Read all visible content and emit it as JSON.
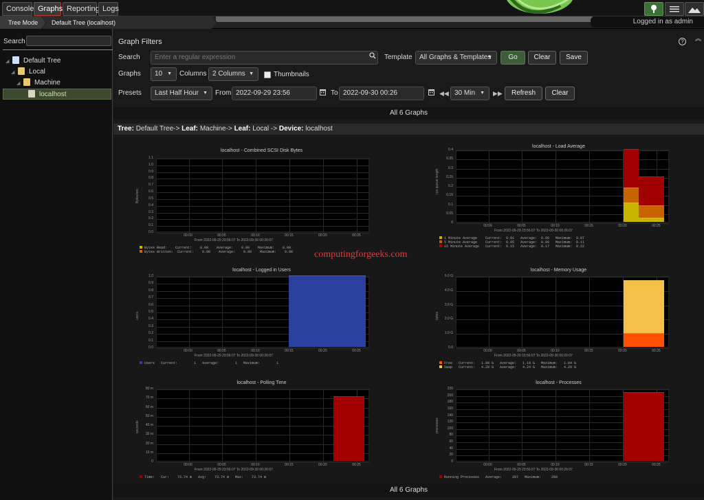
{
  "top_tabs": [
    "Console",
    "Graphs",
    "Reporting",
    "Logs"
  ],
  "active_tab": "Graphs",
  "top_icons": [
    "tree-icon",
    "list-icon",
    "preview-icon"
  ],
  "crumbs": [
    "Tree Mode",
    "Default Tree (localhost)"
  ],
  "login_text": "Logged in as admin",
  "sidebar": {
    "search_label": "Search",
    "tree": [
      {
        "label": "Default Tree",
        "icon": "tree-root-icon",
        "level": 0
      },
      {
        "label": "Local",
        "icon": "folder-icon",
        "level": 1
      },
      {
        "label": "Machine",
        "icon": "folder-icon",
        "level": 2
      },
      {
        "label": "localhost",
        "icon": "device-icon",
        "level": 3,
        "selected": true
      }
    ]
  },
  "filters": {
    "title": "Graph Filters",
    "search_label": "Search",
    "search_placeholder": "Enter a regular expression",
    "template_label": "Template",
    "template_value": "All Graphs & Templates",
    "go": "Go",
    "clear": "Clear",
    "save": "Save",
    "graphs_label": "Graphs",
    "graphs_value": "10",
    "columns_label": "Columns",
    "columns_value": "2 Columns",
    "thumbnails_label": "Thumbnails",
    "presets_label": "Presets",
    "presets_value": "Last Half Hour",
    "from_label": "From",
    "from_value": "2022-09-29 23:56",
    "to_label": "To",
    "to_value": "2022-09-30 00:26",
    "interval_value": "30 Min",
    "refresh": "Refresh",
    "clear2": "Clear"
  },
  "count_label": "All 6 Graphs",
  "tree_path": {
    "tree_k": "Tree:",
    "tree_v": "Default Tree->",
    "leaf1_k": "Leaf:",
    "leaf1_v": "Machine->",
    "leaf2_k": "Leaf:",
    "leaf2_v": "Local ->",
    "device_k": "Device:",
    "device_v": "localhost"
  },
  "watermark": "computingforgeeks.com",
  "x_ticks": [
    "00:00",
    "00:05",
    "00:10",
    "00:15",
    "00:20",
    "00:25"
  ],
  "graphs": [
    {
      "title": "localhost - Combined SCSI Disk Bytes",
      "ylabel": "Bytes/sec",
      "yticks": [
        "1.1",
        "1.0",
        "0.9",
        "0.8",
        "0.7",
        "0.6",
        "0.5",
        "0.4",
        "0.3",
        "0.2",
        "0.1",
        "0.0"
      ],
      "from": "From 2022-09-29 23:56:07 To 2022-09-30 00:26:07",
      "legend": [
        {
          "color": "#d4b800",
          "text": "Bytes Read:    Current:    0.00    Average:    0.00    Maximum:    0.00"
        },
        {
          "color": "#e06000",
          "text": "Bytes Written:  Current:    0.00    Average:    0.00    Maximum:    0.00"
        }
      ]
    },
    {
      "title": "localhost - Load Average",
      "ylabel": "run queue length",
      "yticks": [
        "0.4",
        "0.35",
        "0.3",
        "0.25",
        "0.2",
        "0.15",
        "0.1",
        "0.05",
        "0"
      ],
      "from": "From 2022-09-29 23:56:07 To 2022-09-30 00:26:07",
      "legend": [
        {
          "color": "#c8b400",
          "text": "1 Minute Average    Current:  0.01   Average:  0.06   Maximum:  0.07"
        },
        {
          "color": "#d45a00",
          "text": "5 Minute Average    Current:  0.05   Average:  0.08   Maximum:  0.11"
        },
        {
          "color": "#b00000",
          "text": "15 Minute Average   Current:  0.15   Average:  0.17   Maximum:  0.22"
        }
      ]
    },
    {
      "title": "localhost - Logged in Users",
      "ylabel": "users",
      "yticks": [
        "1.0",
        "0.9",
        "0.8",
        "0.7",
        "0.6",
        "0.5",
        "0.4",
        "0.3",
        "0.2",
        "0.1",
        "0.0"
      ],
      "from": "From 2022-09-29 23:56:07 To 2022-09-30 00:26:07",
      "legend": [
        {
          "color": "#2a3fa0",
          "text": "Users   Current:        1   Average:        1   Maximum:        1"
        }
      ]
    },
    {
      "title": "localhost - Memory Usage",
      "ylabel": "bytes",
      "yticks": [
        "5.0 G",
        "4.0 G",
        "3.0 G",
        "2.0 G",
        "1.0 G",
        "0.0"
      ],
      "from": "From 2022-09-29 23:56:07 To 2022-09-30 00:26:07",
      "legend": [
        {
          "color": "#ff5000",
          "text": "Free   Current:   1.00 G   Average:   1.10 G   Maximum:   1.04 G"
        },
        {
          "color": "#ffc040",
          "text": "Swap   Current:   4.29 G   Average:   4.24 G   Maximum:   4.29 G"
        }
      ]
    },
    {
      "title": "localhost - Polling Time",
      "ylabel": "seconds",
      "yticks": [
        "80 m",
        "70 m",
        "60 m",
        "50 m",
        "40 m",
        "30 m",
        "20 m",
        "10 m",
        "0"
      ],
      "from": "From 2022-09-29 23:56:07 To 2022-09-30 00:26:07",
      "legend": [
        {
          "color": "#a00000",
          "text": "Time:   Cur:    73.74 m   Avg:    73.74 m   Max:    73.74 m"
        }
      ]
    },
    {
      "title": "localhost - Processes",
      "ylabel": "processes",
      "yticks": [
        "220",
        "200",
        "180",
        "160",
        "140",
        "120",
        "100",
        "80",
        "60",
        "40",
        "20",
        "0"
      ],
      "from": "From 2022-09-29 23:56:07 To 2022-09-30 00:26:07",
      "legend": [
        {
          "color": "#a00000",
          "text": "Running Processes   Average:     207   Maximum:     209"
        }
      ]
    }
  ]
}
